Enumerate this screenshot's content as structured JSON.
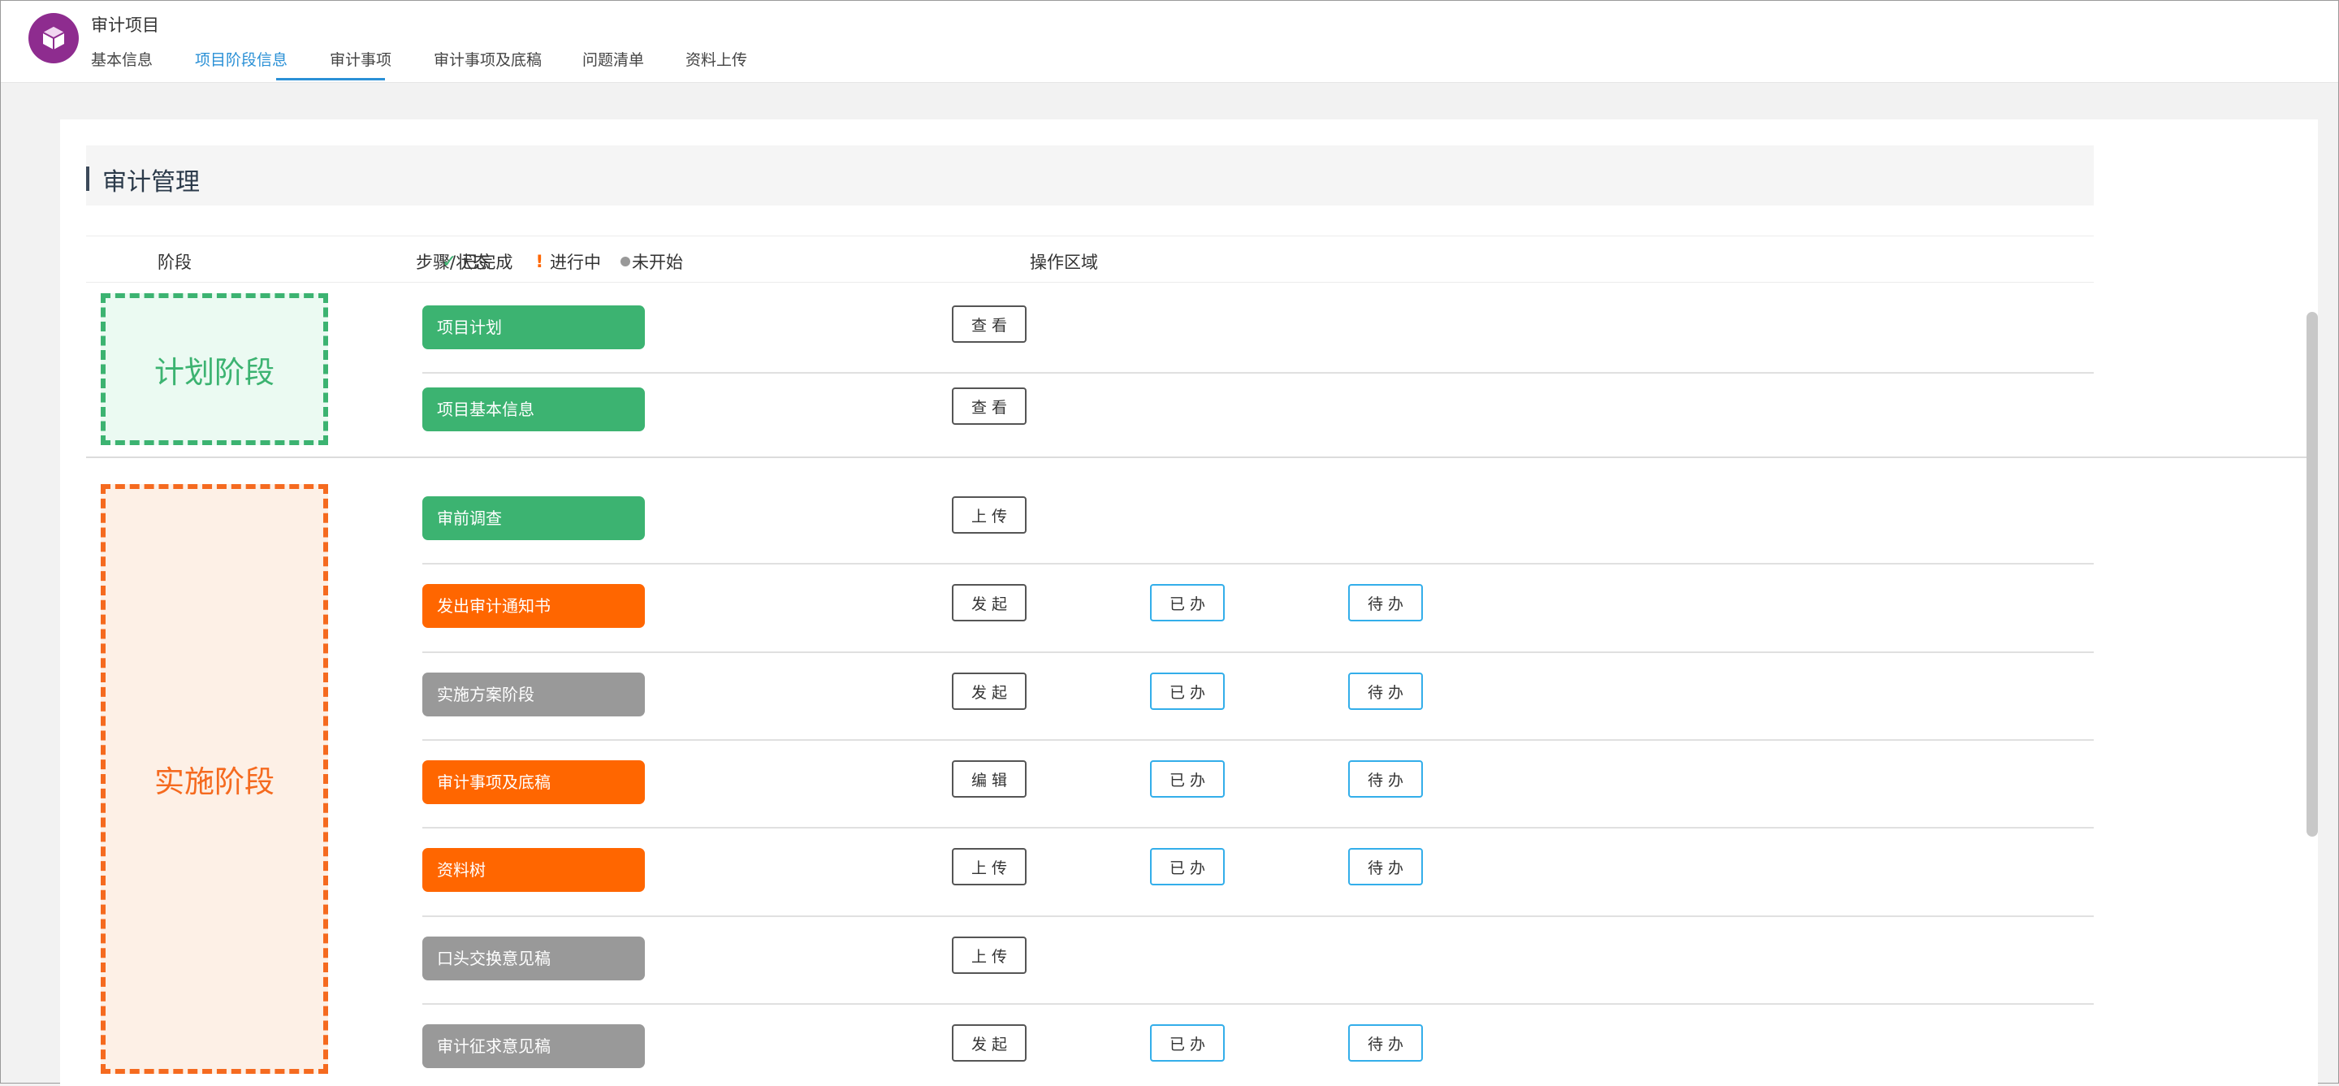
{
  "app": {
    "title": "审计项目",
    "logo_icon": "cube-icon",
    "logo_color": "#8e2c8f"
  },
  "tabs": [
    {
      "label": "基本信息",
      "active": false
    },
    {
      "label": "项目阶段信息",
      "active": true
    },
    {
      "label": "审计事项",
      "active": false
    },
    {
      "label": "审计事项及底稿",
      "active": false
    },
    {
      "label": "问题清单",
      "active": false
    },
    {
      "label": "资料上传",
      "active": false
    }
  ],
  "section": {
    "title": "审计管理"
  },
  "columns": {
    "stage": "阶段",
    "steps": "步骤/状态",
    "actions": "操作区域"
  },
  "legend": {
    "done": "已完成",
    "doing": "进行中",
    "todo": "未开始",
    "done_icon": "check-icon",
    "doing_icon": "exclamation-icon",
    "todo_icon": "dot-icon"
  },
  "colors": {
    "done": "#3cb371",
    "doing": "#ff6600",
    "todo": "#999999",
    "accent": "#2a90d6",
    "outline_blue": "#33aeea"
  },
  "stages": [
    {
      "label": "计划阶段",
      "steps": [
        {
          "label": "项目计划",
          "status": "done",
          "actions": [
            "查看"
          ]
        },
        {
          "label": "项目基本信息",
          "status": "done",
          "actions": [
            "查看"
          ]
        }
      ]
    },
    {
      "label": "实施阶段",
      "steps": [
        {
          "label": "审前调查",
          "status": "done",
          "actions": [
            "上传"
          ]
        },
        {
          "label": "发出审计通知书",
          "status": "doing",
          "actions": [
            "发起",
            "已办",
            "待办"
          ]
        },
        {
          "label": "实施方案阶段",
          "status": "todo",
          "actions": [
            "发起",
            "已办",
            "待办"
          ]
        },
        {
          "label": "审计事项及底稿",
          "status": "doing",
          "actions": [
            "编辑",
            "已办",
            "待办"
          ]
        },
        {
          "label": "资料树",
          "status": "doing",
          "actions": [
            "上传",
            "已办",
            "待办"
          ]
        },
        {
          "label": "口头交换意见稿",
          "status": "todo",
          "actions": [
            "上传"
          ]
        },
        {
          "label": "审计征求意见稿",
          "status": "todo",
          "actions": [
            "发起",
            "已办",
            "待办"
          ]
        }
      ]
    }
  ]
}
